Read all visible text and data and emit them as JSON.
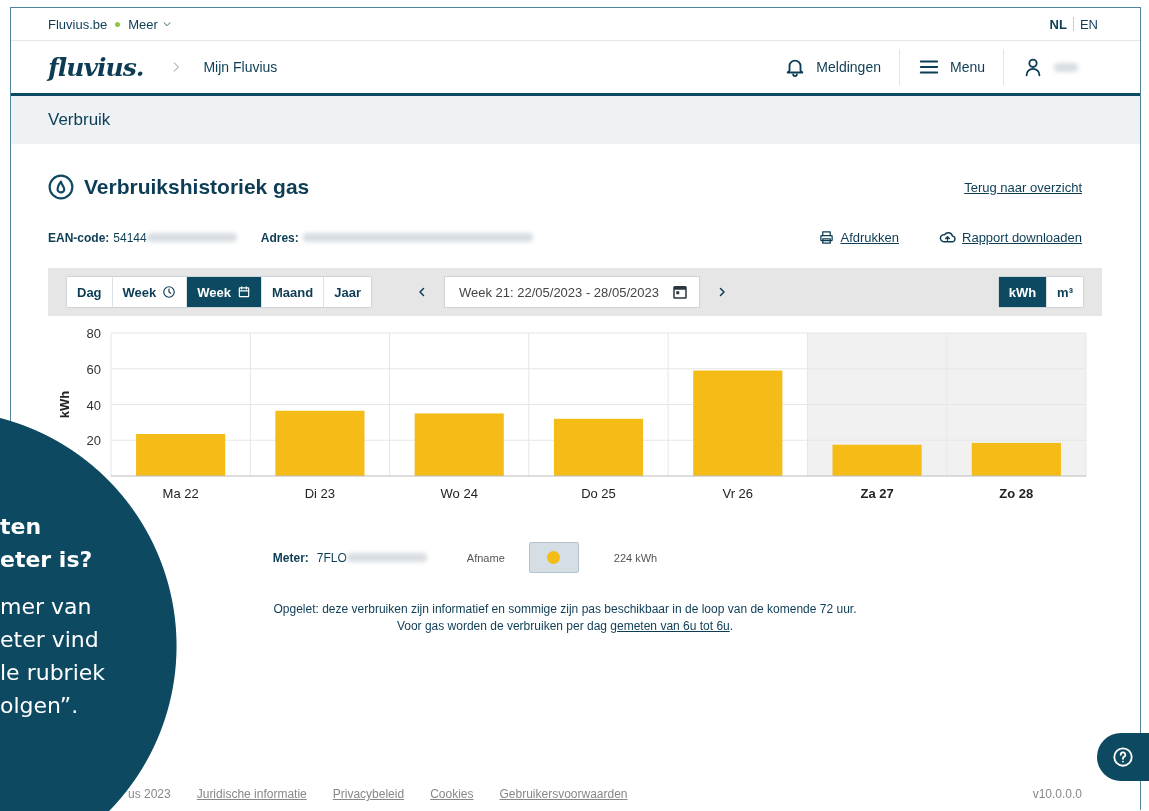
{
  "top_bar": {
    "site_link": "Fluvius.be",
    "more_menu": "Meer",
    "languages": [
      {
        "label": "NL",
        "selected": true
      },
      {
        "label": "EN",
        "selected": false
      }
    ]
  },
  "header": {
    "logo": "fluvius.",
    "breadcrumb": "Mijn Fluvius",
    "notifications": "Meldingen",
    "menu": "Menu"
  },
  "section_bar": {
    "title": "Verbruik"
  },
  "page": {
    "title": "Verbruikshistoriek gas",
    "back_link": "Terug naar overzicht",
    "ean_label": "EAN-code:",
    "ean_value": "54144",
    "address_label": "Adres:",
    "print_link": "Afdrukken",
    "download_link": "Rapport downloaden"
  },
  "period_tabs": [
    {
      "label": "Dag",
      "kind": "plain",
      "selected": false
    },
    {
      "label": "Week",
      "kind": "clock",
      "selected": false
    },
    {
      "label": "Week",
      "kind": "calendar",
      "selected": true
    },
    {
      "label": "Maand",
      "kind": "plain",
      "selected": false
    },
    {
      "label": "Jaar",
      "kind": "plain",
      "selected": false
    }
  ],
  "date_range": "Week 21: 22/05/2023 - 28/05/2023",
  "units": [
    {
      "label": "kWh",
      "selected": true
    },
    {
      "label": "m³",
      "selected": false
    }
  ],
  "chart": {
    "highlight": [
      false,
      false,
      false,
      false,
      false,
      true,
      true
    ],
    "chart_data": {
      "type": "bar",
      "ylabel": "kWh",
      "categories": [
        "Ma 22",
        "Di 23",
        "Wo 24",
        "Do 25",
        "Vr 26",
        "Za 27",
        "Zo 28"
      ],
      "series": [
        {
          "name": "Afname",
          "color": "#f5bc17",
          "values": [
            23.5,
            36.5,
            35,
            32,
            59,
            17.5,
            18.5
          ]
        }
      ],
      "ylim": [
        0,
        80
      ],
      "yticks": [
        20,
        40,
        60,
        80
      ],
      "grid": true
    }
  },
  "meter": {
    "label": "Meter:",
    "value": "7FLO",
    "series_on": true,
    "total": "224 kWh"
  },
  "notes": [
    {
      "text": "Opgelet: deze verbruiken zijn informatief en sommige zijn pas beschikbaar in de loop van de komende 72 uur."
    },
    {
      "text": "Voor gas worden de verbruiken per dag ",
      "link": "gemeten van 6u tot 6u",
      "after": "."
    }
  ],
  "overlay": {
    "heading": [
      "ten",
      "eter is?"
    ],
    "body": [
      "mer van",
      "eter vind",
      "le rubriek",
      "olgen”."
    ]
  },
  "footer": {
    "copyright": "us 2023",
    "links": [
      "Juridische informatie",
      "Privacybeleid",
      "Cookies",
      "Gebruikersvoorwaarden"
    ],
    "version": "v10.0.0.0"
  }
}
